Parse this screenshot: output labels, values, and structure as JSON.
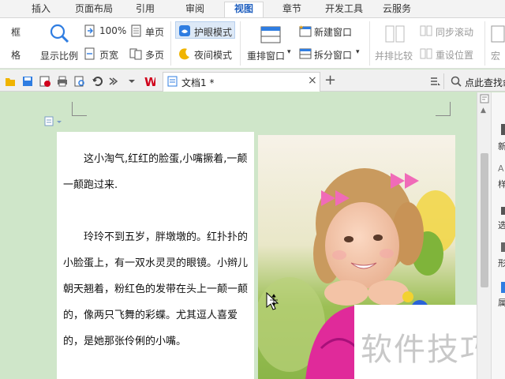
{
  "tabs": [
    "插入",
    "页面布局",
    "引用",
    "审阅",
    "视图",
    "章节",
    "开发工具",
    "云服务"
  ],
  "active_tab": "视图",
  "ribbon": {
    "left_cut_top": "框",
    "left_cut_bottom": "格",
    "show_ratio": "显示比例",
    "zoom_100": "100%",
    "page_width": "页宽",
    "single_page": "单页",
    "multi_page": "多页",
    "eye_mode": "护眼模式",
    "night_mode": "夜间模式",
    "rearrange_window": "重排窗口",
    "new_window": "新建窗口",
    "split_window": "拆分窗口",
    "side_by_side": "并排比较",
    "sync_scroll": "同步滚动",
    "reset_position": "重设位置",
    "macro_cut": "宏"
  },
  "document_tab": {
    "title": "文档1 *",
    "close": "×",
    "new_tab": "+"
  },
  "search_hint": "点此查找命",
  "document": {
    "paragraphs": [
      "这小淘气,红红的脸蛋,小嘴撅着,一颠一颠跑过来.",
      "玲玲不到五岁，胖墩墩的。红扑扑的小脸蛋上，有一双水灵灵的眼镜。小辫儿朝天翘着，粉红色的发带在头上一颠一颠的，像两只飞舞的彩蝶。尤其逗人喜爱的，是她那张伶俐的小嘴。"
    ]
  },
  "watermark": "软件技巧",
  "right_panel": [
    "新",
    "样",
    "选",
    "形",
    "属"
  ],
  "colors": {
    "accent": "#1f5fbf",
    "doc_background": "#cfe6c9",
    "ribbon_highlight": "#dde9f7",
    "wps_red": "#d0021b"
  },
  "icons": [
    "zoom-icon",
    "page-width-icon",
    "single-page-icon",
    "multi-page-icon",
    "eye-mode-icon",
    "night-mode-icon",
    "rearrange-window-icon",
    "new-window-icon",
    "split-window-icon",
    "side-by-side-icon",
    "sync-scroll-icon",
    "reset-position-icon",
    "open-folder-icon",
    "save-icon",
    "pdf-icon",
    "print-icon",
    "preview-icon",
    "undo-icon",
    "redo-icon",
    "wps-logo-icon",
    "doc-icon",
    "search-icon"
  ]
}
